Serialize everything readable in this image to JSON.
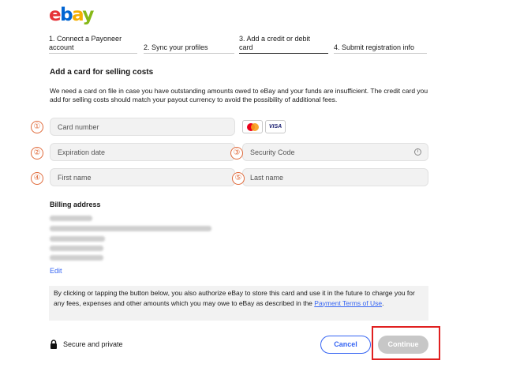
{
  "logo": {
    "e": "e",
    "b": "b",
    "a": "a",
    "y": "y"
  },
  "steps": [
    {
      "line1": "1. Connect a Payoneer",
      "line2": "account"
    },
    {
      "line1": "2. Sync your profiles",
      "line2": ""
    },
    {
      "line1": "3. Add a credit or debit",
      "line2": "card"
    },
    {
      "line1": "4. Submit registration info",
      "line2": ""
    }
  ],
  "section": {
    "title": "Add a card for selling costs",
    "description": "We need a card on file in case you have outstanding amounts owed to eBay and your funds are insufficient. The credit card you add for selling costs should match your payout currency to avoid the possibility of additional fees."
  },
  "fields": {
    "card_number": "Card number",
    "expiration_date": "Expiration date",
    "security_code": "Security Code",
    "first_name": "First name",
    "last_name": "Last name"
  },
  "markers": [
    "①",
    "②",
    "③",
    "④",
    "⑤"
  ],
  "card_logos": {
    "mastercard": "mastercard-logo",
    "visa": "VISA"
  },
  "billing": {
    "title": "Billing address",
    "edit": "Edit"
  },
  "terms": {
    "text": "By clicking or tapping the button below, you also authorize eBay to store this card and use it in the future to charge you for any fees, expenses and other amounts which you may owe to eBay as described in the ",
    "link": "Payment Terms of Use",
    "end": "."
  },
  "secure": {
    "label": "Secure and private",
    "icon": "lock-icon"
  },
  "buttons": {
    "cancel": "Cancel",
    "continue": "Continue"
  },
  "colors": {
    "link": "#3665f3",
    "marker": "#e06a3a",
    "highlight": "#e02020",
    "disabled": "#c7c7c7"
  }
}
